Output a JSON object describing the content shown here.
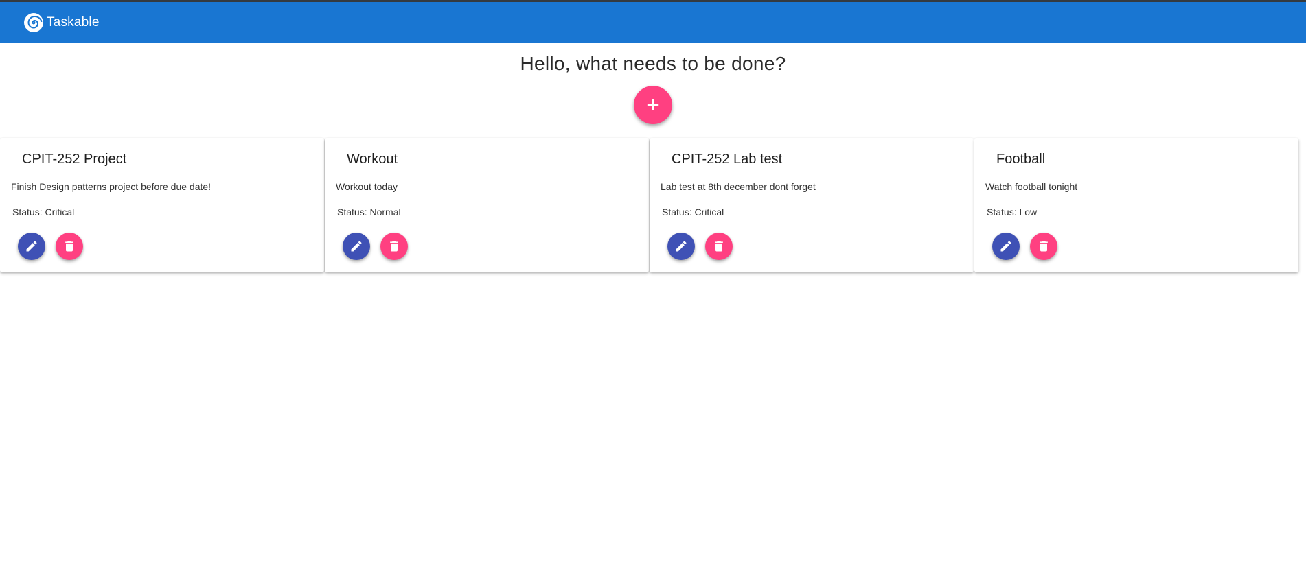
{
  "app": {
    "name": "Taskable",
    "logo_icon": "spiral-logo-icon",
    "colors": {
      "navbar": "#1976d2",
      "accent": "#ff4081",
      "primary_button": "#3f51b5"
    }
  },
  "hero": {
    "title": "Hello, what needs to be done?",
    "add_button_label": "+"
  },
  "tasks": [
    {
      "title": "CPIT-252 Project",
      "description": "Finish Design patterns project before due date!",
      "status": "Status: Critical",
      "edit_icon": "pencil-icon",
      "delete_icon": "trash-icon"
    },
    {
      "title": "Workout",
      "description": "Workout today",
      "status": "Status: Normal",
      "edit_icon": "pencil-icon",
      "delete_icon": "trash-icon"
    },
    {
      "title": "CPIT-252 Lab test",
      "description": "Lab test at 8th december dont forget",
      "status": "Status: Critical",
      "edit_icon": "pencil-icon",
      "delete_icon": "trash-icon"
    },
    {
      "title": "Football",
      "description": "Watch football tonight",
      "status": "Status: Low",
      "edit_icon": "pencil-icon",
      "delete_icon": "trash-icon"
    }
  ]
}
